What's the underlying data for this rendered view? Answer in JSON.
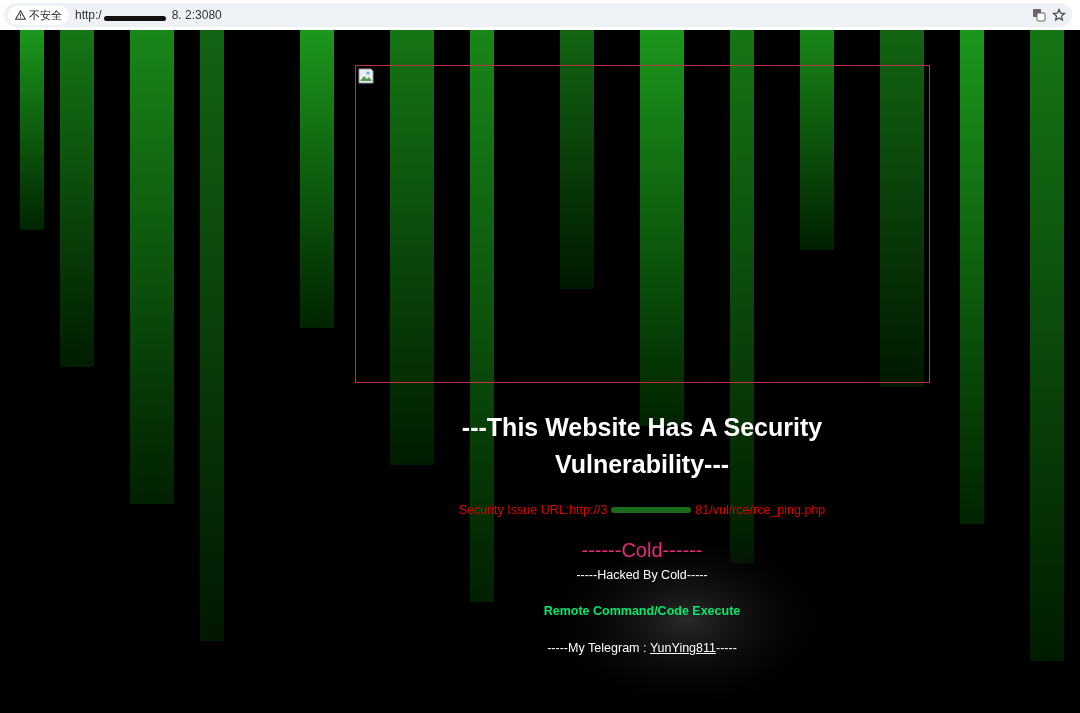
{
  "browser": {
    "security_label": "不安全",
    "url_parts": [
      "http:/",
      "8.",
      "2:3080"
    ]
  },
  "page": {
    "background": {
      "kind": "picture"
    },
    "image": {
      "kind": "broken-image"
    },
    "heading": "---This Website Has A Security Vulnerability---",
    "issue_url_parts": [
      "Security Issue URL:http://3",
      "81/vul/rce/rce_ping.php"
    ],
    "signature": "------Cold------",
    "hacked_by": "-----Hacked By Cold-----",
    "attack_type": "Remote Command/Code Execute",
    "telegram": {
      "prefix": "-----My Telegram : ",
      "link": "YunYing811",
      "suffix": "-----"
    }
  }
}
